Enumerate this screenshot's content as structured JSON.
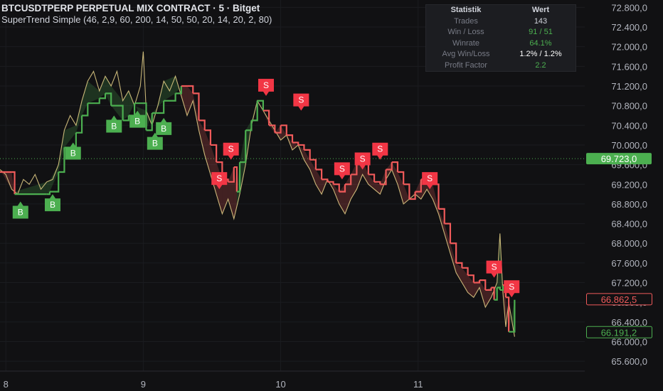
{
  "header": {
    "title": "BTCUSDTPERP PERPETUAL MIX CONTRACT · 5 · Bitget",
    "subtitle": "SuperTrend Simple (46, 2,9, 60, 200, 14, 50, 50, 20, 14, 20, 2, 80)"
  },
  "stats": {
    "col1": "Statistik",
    "col2": "Wert",
    "rows": [
      {
        "label": "Trades",
        "value": "143",
        "color": "#d1d4dc"
      },
      {
        "label": "Win / Loss",
        "value": "91 / 51",
        "color": "#4caf50"
      },
      {
        "label": "Winrate",
        "value": "64.1%",
        "color": "#4caf50"
      },
      {
        "label": "Avg Win/Loss",
        "value": "1.2% / 1.2%",
        "color": "#ffffff"
      },
      {
        "label": "Profit Factor",
        "value": "2.2",
        "color": "#4caf50"
      }
    ]
  },
  "colors": {
    "background": "#111113",
    "up": "#4caf50",
    "down": "#f05a5a",
    "buy_label": "#4caf50",
    "sell_label": "#f23645",
    "axis_text": "#b2b5be"
  },
  "chart_data": {
    "type": "line",
    "y_axis": {
      "ylim": [
        65400,
        72950
      ],
      "ticks": [
        65600,
        66000,
        66400,
        66800,
        67200,
        67600,
        68000,
        68400,
        68800,
        69200,
        69600,
        70000,
        70400,
        70800,
        71200,
        71600,
        72000,
        72400,
        72800
      ],
      "tick_labels": [
        "65.600,0",
        "66.000,0",
        "66.400,0",
        "66.800,0",
        "67.200,0",
        "67.600,0",
        "68.000,0",
        "68.400,0",
        "68.800,0",
        "69.200,0",
        "69.600,0",
        "70.000,0",
        "70.400,0",
        "70.800,0",
        "71.200,0",
        "71.600,0",
        "72.000,0",
        "72.400,0",
        "72.800,0"
      ]
    },
    "x_axis": {
      "xlim": [
        0,
        100
      ],
      "ticks": [
        1,
        24.5,
        48,
        71.5
      ],
      "tick_labels": [
        "8",
        "9",
        "10",
        "11"
      ]
    },
    "price_labels": [
      {
        "value": 69723.0,
        "text": "69.723,0",
        "style": "filled",
        "color": "#4caf50"
      },
      {
        "value": 66862.5,
        "text": "66.862,5",
        "style": "outline",
        "color": "#f05a5a"
      },
      {
        "value": 66191.2,
        "text": "66.191,2",
        "style": "outline",
        "color": "#4caf50"
      }
    ],
    "current_price_line": 69723,
    "series": [
      {
        "name": "Price",
        "color": "#e8d28a",
        "points": [
          [
            0,
            69500
          ],
          [
            1,
            69400
          ],
          [
            2,
            69100
          ],
          [
            3,
            69000
          ],
          [
            4,
            69300
          ],
          [
            5,
            69200
          ],
          [
            6,
            69400
          ],
          [
            7,
            69100
          ],
          [
            8,
            69250
          ],
          [
            9,
            69300
          ],
          [
            10,
            69600
          ],
          [
            11,
            70300
          ],
          [
            12,
            70600
          ],
          [
            13,
            70400
          ],
          [
            14,
            70900
          ],
          [
            15,
            71300
          ],
          [
            16,
            71500
          ],
          [
            17,
            71100
          ],
          [
            18,
            71400
          ],
          [
            19,
            71200
          ],
          [
            20,
            71500
          ],
          [
            21,
            70900
          ],
          [
            22,
            71100
          ],
          [
            23,
            70800
          ],
          [
            24,
            71200
          ],
          [
            24.5,
            71900
          ],
          [
            25,
            70700
          ],
          [
            26,
            70400
          ],
          [
            27,
            70800
          ],
          [
            28,
            71300
          ],
          [
            29,
            71100
          ],
          [
            30,
            71400
          ],
          [
            31,
            71000
          ],
          [
            32,
            70600
          ],
          [
            33,
            70900
          ],
          [
            34,
            70300
          ],
          [
            35,
            69800
          ],
          [
            36,
            69400
          ],
          [
            37,
            69000
          ],
          [
            38,
            68600
          ],
          [
            39,
            68900
          ],
          [
            40,
            68500
          ],
          [
            41,
            69000
          ],
          [
            42,
            69600
          ],
          [
            43,
            70400
          ],
          [
            44,
            70900
          ],
          [
            45,
            70700
          ],
          [
            46,
            70500
          ],
          [
            47,
            70300
          ],
          [
            48,
            70100
          ],
          [
            49,
            70200
          ],
          [
            50,
            69900
          ],
          [
            51,
            70000
          ],
          [
            52,
            69700
          ],
          [
            53,
            69500
          ],
          [
            54,
            69200
          ],
          [
            55,
            69000
          ],
          [
            56,
            69300
          ],
          [
            57,
            69100
          ],
          [
            58,
            68800
          ],
          [
            59,
            68600
          ],
          [
            60,
            68900
          ],
          [
            61,
            69100
          ],
          [
            62,
            69400
          ],
          [
            63,
            69200
          ],
          [
            64,
            69100
          ],
          [
            65,
            69000
          ],
          [
            66,
            69300
          ],
          [
            67,
            69500
          ],
          [
            68,
            69200
          ],
          [
            69,
            68800
          ],
          [
            70,
            68900
          ],
          [
            71,
            69000
          ],
          [
            72,
            68900
          ],
          [
            73,
            69100
          ],
          [
            74,
            68900
          ],
          [
            75,
            68600
          ],
          [
            76,
            68200
          ],
          [
            77,
            67800
          ],
          [
            78,
            67400
          ],
          [
            79,
            67200
          ],
          [
            80,
            67000
          ],
          [
            81,
            66900
          ],
          [
            82,
            67100
          ],
          [
            83,
            66700
          ],
          [
            84,
            66900
          ],
          [
            85,
            67200
          ],
          [
            85.5,
            68200
          ],
          [
            86,
            67000
          ],
          [
            86.5,
            66300
          ],
          [
            87,
            66800
          ],
          [
            88,
            66100
          ]
        ]
      },
      {
        "name": "Trend Line",
        "color_up": "#4caf50",
        "color_down": "#f05a5a",
        "points": [
          [
            0,
            69450,
            "d"
          ],
          [
            2,
            69450,
            "d"
          ],
          [
            2.5,
            69000,
            "u"
          ],
          [
            8,
            69000,
            "u"
          ],
          [
            8.5,
            69050,
            "u"
          ],
          [
            10,
            69450,
            "u"
          ],
          [
            11,
            69950,
            "u"
          ],
          [
            13,
            70250,
            "u"
          ],
          [
            14,
            70600,
            "u"
          ],
          [
            15,
            70850,
            "u"
          ],
          [
            17,
            70950,
            "u"
          ],
          [
            18,
            71050,
            "u"
          ],
          [
            19,
            70800,
            "u"
          ],
          [
            21,
            70500,
            "u"
          ],
          [
            22,
            70600,
            "u"
          ],
          [
            23,
            70850,
            "u"
          ],
          [
            25,
            70300,
            "u"
          ],
          [
            26,
            70650,
            "u"
          ],
          [
            28,
            70900,
            "u"
          ],
          [
            30,
            71050,
            "u"
          ],
          [
            31,
            71200,
            "d"
          ],
          [
            32,
            71200,
            "d"
          ],
          [
            33,
            71050,
            "d"
          ],
          [
            34,
            70500,
            "d"
          ],
          [
            35,
            70300,
            "d"
          ],
          [
            36,
            70000,
            "d"
          ],
          [
            37,
            69650,
            "d"
          ],
          [
            38,
            69300,
            "d"
          ],
          [
            39,
            69250,
            "d"
          ],
          [
            40,
            69550,
            "d"
          ],
          [
            40.5,
            69050,
            "u"
          ],
          [
            41,
            69650,
            "u"
          ],
          [
            42,
            70300,
            "u"
          ],
          [
            43,
            70500,
            "u"
          ],
          [
            44,
            70900,
            "u"
          ],
          [
            45,
            70700,
            "d"
          ],
          [
            46,
            70400,
            "d"
          ],
          [
            47,
            70250,
            "d"
          ],
          [
            48,
            70400,
            "d"
          ],
          [
            49,
            70200,
            "d"
          ],
          [
            50,
            70050,
            "d"
          ],
          [
            51,
            70000,
            "d"
          ],
          [
            52,
            69900,
            "d"
          ],
          [
            53,
            69700,
            "d"
          ],
          [
            54,
            69500,
            "d"
          ],
          [
            55,
            69300,
            "d"
          ],
          [
            56,
            69250,
            "d"
          ],
          [
            57,
            69200,
            "d"
          ],
          [
            58,
            69050,
            "d"
          ],
          [
            59,
            69200,
            "d"
          ],
          [
            60,
            69400,
            "d"
          ],
          [
            61,
            69650,
            "d"
          ],
          [
            62,
            69700,
            "d"
          ],
          [
            63,
            69400,
            "d"
          ],
          [
            64,
            69250,
            "d"
          ],
          [
            65,
            69200,
            "d"
          ],
          [
            66,
            69500,
            "d"
          ],
          [
            67,
            69650,
            "d"
          ],
          [
            68,
            69450,
            "d"
          ],
          [
            69,
            69200,
            "d"
          ],
          [
            70,
            68900,
            "d"
          ],
          [
            71,
            69050,
            "d"
          ],
          [
            72,
            69300,
            "d"
          ],
          [
            73,
            69200,
            "d"
          ],
          [
            74,
            69200,
            "d"
          ],
          [
            75,
            68700,
            "d"
          ],
          [
            76,
            68400,
            "d"
          ],
          [
            77,
            68000,
            "d"
          ],
          [
            78,
            67600,
            "d"
          ],
          [
            79,
            67500,
            "d"
          ],
          [
            80,
            67350,
            "d"
          ],
          [
            81,
            67200,
            "d"
          ],
          [
            82,
            67250,
            "d"
          ],
          [
            83,
            67050,
            "d"
          ],
          [
            84,
            67100,
            "d"
          ],
          [
            84.5,
            66850,
            "u"
          ],
          [
            85,
            67100,
            "u"
          ],
          [
            85.5,
            67050,
            "u"
          ],
          [
            86,
            67150,
            "d"
          ],
          [
            86.5,
            66900,
            "d"
          ],
          [
            87,
            66200,
            "u"
          ],
          [
            88,
            66850,
            "d"
          ]
        ]
      }
    ],
    "markers": [
      {
        "x": 3.5,
        "y": 68850,
        "type": "buy",
        "label": "B"
      },
      {
        "x": 9,
        "y": 69000,
        "type": "buy",
        "label": "B"
      },
      {
        "x": 12.5,
        "y": 70050,
        "type": "buy",
        "label": "B"
      },
      {
        "x": 19.5,
        "y": 70600,
        "type": "buy",
        "label": "B"
      },
      {
        "x": 23.5,
        "y": 70700,
        "type": "buy",
        "label": "B"
      },
      {
        "x": 26.5,
        "y": 70250,
        "type": "buy",
        "label": "B"
      },
      {
        "x": 28,
        "y": 70550,
        "type": "buy",
        "label": "B"
      },
      {
        "x": 39.5,
        "y": 69700,
        "type": "sell",
        "label": "S"
      },
      {
        "x": 37.5,
        "y": 69100,
        "type": "sell",
        "label": "S"
      },
      {
        "x": 45.5,
        "y": 71000,
        "type": "sell",
        "label": "S"
      },
      {
        "x": 51.5,
        "y": 70700,
        "type": "sell",
        "label": "S"
      },
      {
        "x": 58.5,
        "y": 69300,
        "type": "sell",
        "label": "S"
      },
      {
        "x": 62,
        "y": 69500,
        "type": "sell",
        "label": "S"
      },
      {
        "x": 65,
        "y": 69700,
        "type": "sell",
        "label": "S"
      },
      {
        "x": 73.5,
        "y": 69100,
        "type": "sell",
        "label": "S"
      },
      {
        "x": 84.5,
        "y": 67300,
        "type": "sell",
        "label": "S"
      },
      {
        "x": 87.5,
        "y": 66900,
        "type": "sell",
        "label": "S"
      }
    ]
  }
}
